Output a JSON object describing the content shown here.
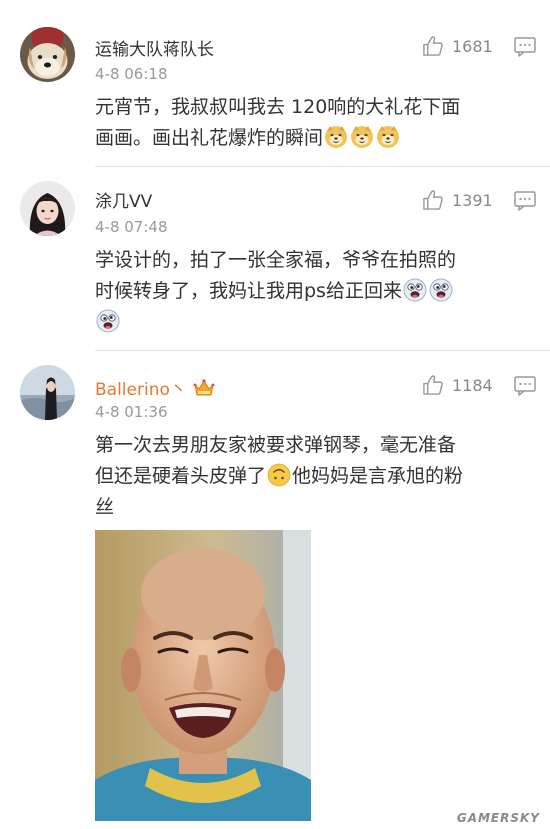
{
  "comments": [
    {
      "username": "运输大队蒋队长",
      "time": "4-8 06:18",
      "likes": "1681",
      "lines": [
        "元宵节，我叔叔叫我去 120响的大礼花下面",
        "画画。画出礼花爆炸的瞬间"
      ],
      "emojis": [
        "doge-icon",
        "doge-icon",
        "doge-icon"
      ]
    },
    {
      "username": "涂几VV",
      "time": "4-8 07:48",
      "likes": "1391",
      "lines": [
        "学设计的，拍了一张全家福，爷爷在拍照的",
        "时候转身了，我妈让我用ps给正回来"
      ],
      "emojis": [
        "crazy-face-icon",
        "crazy-face-icon",
        "crazy-face-icon"
      ]
    },
    {
      "username": "Ballerino丶",
      "username_color": "#e8782c",
      "time": "4-8 01:36",
      "likes": "1184",
      "lines": [
        "第一次去男朋友家被要求弹钢琴，毫无准备",
        "但还是硬着头皮弹了",
        "他妈妈是言承旭的粉",
        "丝"
      ],
      "emojis": [
        "upside-down-face-icon"
      ]
    }
  ],
  "watermark": "GAMERSKY",
  "colors": {
    "username": "#333333",
    "vip_username": "#e8782c",
    "meta": "#999999",
    "divider": "#e6e6e6"
  }
}
